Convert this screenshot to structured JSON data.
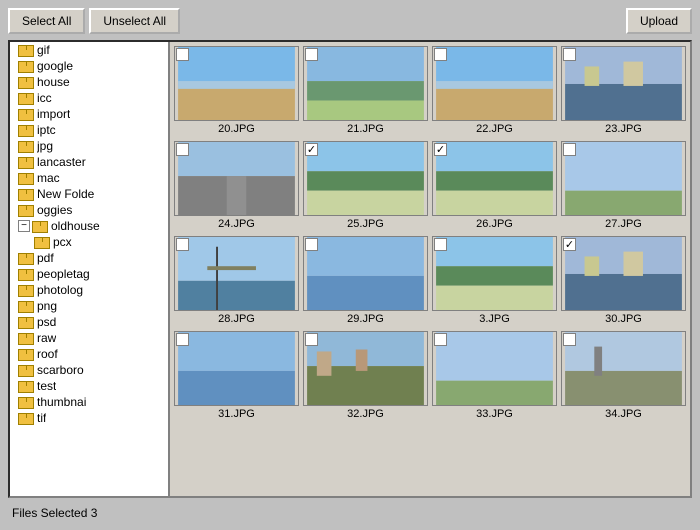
{
  "toolbar": {
    "select_all_label": "Select All",
    "unselect_all_label": "Unselect All",
    "upload_label": "Upload"
  },
  "sidebar": {
    "items": [
      {
        "label": "gif",
        "has_expand": false,
        "indent": 0
      },
      {
        "label": "google",
        "has_expand": false,
        "indent": 0
      },
      {
        "label": "house",
        "has_expand": false,
        "indent": 0
      },
      {
        "label": "icc",
        "has_expand": false,
        "indent": 0
      },
      {
        "label": "import",
        "has_expand": false,
        "indent": 0
      },
      {
        "label": "iptc",
        "has_expand": false,
        "indent": 0
      },
      {
        "label": "jpg",
        "has_expand": false,
        "indent": 0
      },
      {
        "label": "lancaster",
        "has_expand": false,
        "indent": 0
      },
      {
        "label": "mac",
        "has_expand": false,
        "indent": 0
      },
      {
        "label": "New Folde",
        "has_expand": false,
        "indent": 0
      },
      {
        "label": "oggies",
        "has_expand": false,
        "indent": 0
      },
      {
        "label": "oldhouse",
        "has_expand": true,
        "indent": 0,
        "expanded": true
      },
      {
        "label": "pcx",
        "has_expand": false,
        "indent": 1
      },
      {
        "label": "pdf",
        "has_expand": false,
        "indent": 0
      },
      {
        "label": "peopletag",
        "has_expand": false,
        "indent": 0
      },
      {
        "label": "photolog",
        "has_expand": false,
        "indent": 0
      },
      {
        "label": "png",
        "has_expand": false,
        "indent": 0
      },
      {
        "label": "psd",
        "has_expand": false,
        "indent": 0
      },
      {
        "label": "raw",
        "has_expand": false,
        "indent": 0
      },
      {
        "label": "roof",
        "has_expand": false,
        "indent": 0
      },
      {
        "label": "scarboro",
        "has_expand": false,
        "indent": 0
      },
      {
        "label": "test",
        "has_expand": false,
        "indent": 0
      },
      {
        "label": "thumbnai",
        "has_expand": false,
        "indent": 0
      },
      {
        "label": "tif",
        "has_expand": false,
        "indent": 0
      }
    ]
  },
  "images": [
    {
      "name": "20.JPG",
      "checked": false,
      "theme": "beach"
    },
    {
      "name": "21.JPG",
      "checked": false,
      "theme": "cliff"
    },
    {
      "name": "22.JPG",
      "checked": false,
      "theme": "beach"
    },
    {
      "name": "23.JPG",
      "checked": false,
      "theme": "harbor"
    },
    {
      "name": "24.JPG",
      "checked": false,
      "theme": "road"
    },
    {
      "name": "25.JPG",
      "checked": true,
      "theme": "coast"
    },
    {
      "name": "26.JPG",
      "checked": true,
      "theme": "coast"
    },
    {
      "name": "27.JPG",
      "checked": false,
      "theme": "sky"
    },
    {
      "name": "28.JPG",
      "checked": false,
      "theme": "pier"
    },
    {
      "name": "29.JPG",
      "checked": false,
      "theme": "sea"
    },
    {
      "name": "3.JPG",
      "checked": false,
      "theme": "coast"
    },
    {
      "name": "30.JPG",
      "checked": true,
      "theme": "harbor"
    },
    {
      "name": "31.JPG",
      "checked": false,
      "theme": "sea"
    },
    {
      "name": "32.JPG",
      "checked": false,
      "theme": "town"
    },
    {
      "name": "33.JPG",
      "checked": false,
      "theme": "sky"
    },
    {
      "name": "34.JPG",
      "checked": false,
      "theme": "street"
    }
  ],
  "status": {
    "text": "Files Selected  3"
  }
}
